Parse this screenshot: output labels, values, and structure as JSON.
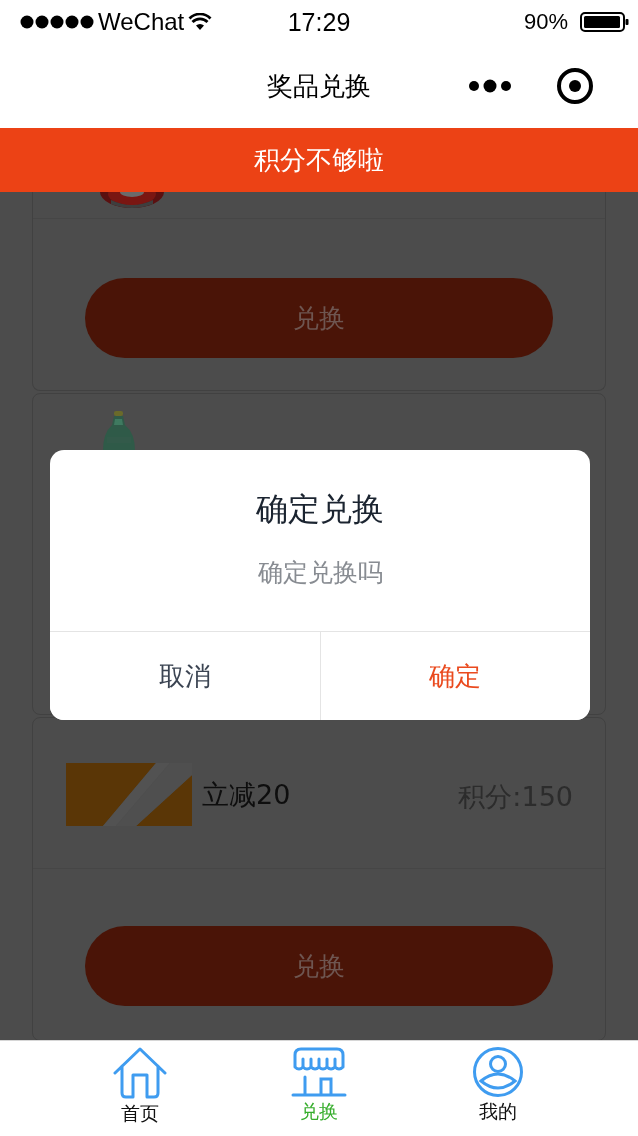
{
  "status_bar": {
    "carrier": "WeChat",
    "time": "17:29",
    "battery": "90%"
  },
  "nav": {
    "title": "奖品兑换"
  },
  "toast": "积分不够啦",
  "cards": [
    {
      "button": "兑换"
    },
    {
      "name": "立减20",
      "points": "积分:150",
      "button": "兑换"
    }
  ],
  "dialog": {
    "title": "确定兑换",
    "message": "确定兑换吗",
    "buttons": [
      {
        "label": "取消",
        "kind": "cancel"
      },
      {
        "label": "确定",
        "kind": "confirm"
      }
    ]
  },
  "tabs": [
    {
      "label": "首页",
      "selected": false
    },
    {
      "label": "兑换",
      "selected": true
    },
    {
      "label": "我的",
      "selected": false
    }
  ]
}
